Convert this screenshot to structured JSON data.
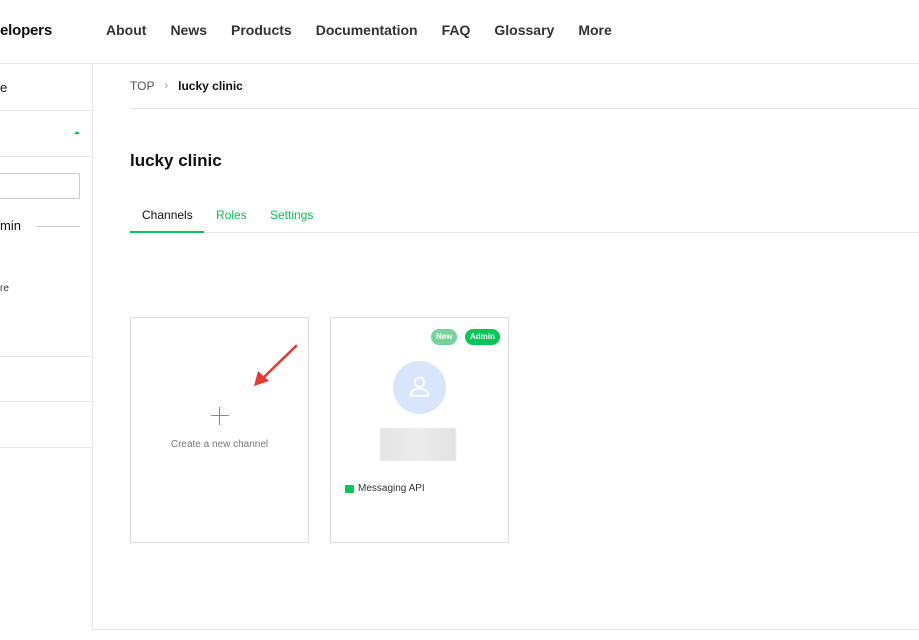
{
  "header": {
    "brand": "elopers",
    "nav": [
      "About",
      "News",
      "Products",
      "Documentation",
      "FAQ",
      "Glossary",
      "More"
    ]
  },
  "sidebar": {
    "top_text": "e",
    "admin_text": "min",
    "re_text": "re"
  },
  "breadcrumb": {
    "top": "TOP",
    "separator": "›",
    "current": "lucky clinic"
  },
  "page": {
    "title": "lucky clinic"
  },
  "tabs": [
    {
      "label": "Channels",
      "active": true
    },
    {
      "label": "Roles",
      "active": false
    },
    {
      "label": "Settings",
      "active": false
    }
  ],
  "cards": {
    "create": {
      "label": "Create a new channel"
    },
    "channel": {
      "badges": [
        "New",
        "Admin"
      ],
      "type_label": "Messaging API"
    }
  },
  "colors": {
    "accent": "#06c755",
    "arrow": "#e53935",
    "avatar_bg": "#d8e5fb"
  },
  "icons": {
    "avatar": "user-icon",
    "create": "plus-icon",
    "channel_type": "chat-icon"
  }
}
